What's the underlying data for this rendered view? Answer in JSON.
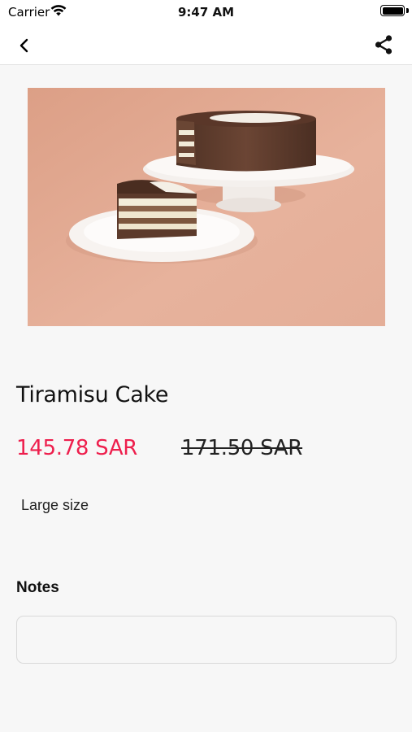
{
  "status_bar": {
    "carrier": "Carrier",
    "time": "9:47 AM",
    "battery_level": 1.0
  },
  "nav": {
    "back_icon": "chevron-left-icon",
    "share_icon": "share-icon"
  },
  "product": {
    "image_description_icon": "cake-photo",
    "title": "Tiramisu Cake",
    "price_current": "145.78 SAR",
    "price_old": "171.50 SAR",
    "size": "Large size"
  },
  "notes": {
    "label": "Notes",
    "value": "",
    "placeholder": ""
  },
  "colors": {
    "accent_price": "#ee1f4d",
    "image_background": "#e1a992"
  }
}
